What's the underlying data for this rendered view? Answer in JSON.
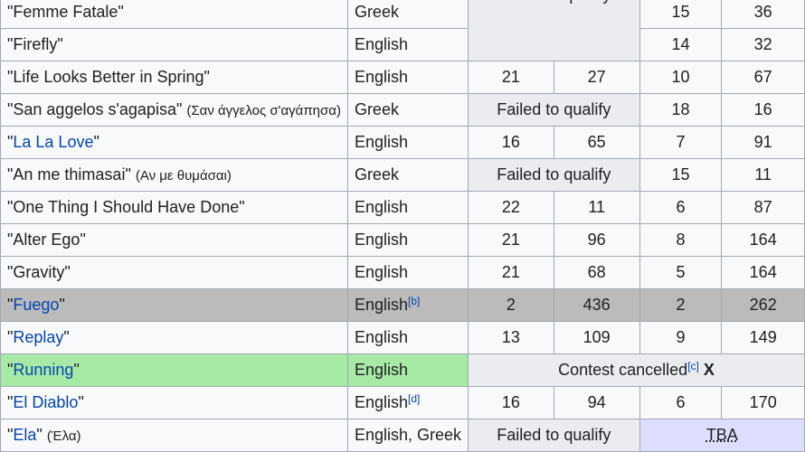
{
  "failed_label": "Failed to qualify",
  "rows": [
    {
      "title": "Femme Fatale",
      "alt": "",
      "linked": false,
      "language": "Greek",
      "sup": "",
      "pos1": "",
      "pts1": "",
      "pos2": "15",
      "pts2": "36"
    },
    {
      "title": "Firefly",
      "alt": "",
      "linked": false,
      "language": "English",
      "sup": "",
      "pos1": "",
      "pts1": "",
      "pos2": "14",
      "pts2": "32"
    },
    {
      "title": "Life Looks Better in Spring",
      "alt": "",
      "linked": false,
      "language": "English",
      "sup": "",
      "pos1": "21",
      "pts1": "27",
      "pos2": "10",
      "pts2": "67"
    },
    {
      "title": "San aggelos s'agapisa",
      "alt": "(Σαν άγγελος σ'αγάπησα)",
      "linked": false,
      "language": "Greek",
      "sup": "",
      "pos1": "",
      "pts1": "",
      "pos2": "18",
      "pts2": "16"
    },
    {
      "title": "La La Love",
      "alt": "",
      "linked": true,
      "language": "English",
      "sup": "",
      "pos1": "16",
      "pts1": "65",
      "pos2": "7",
      "pts2": "91"
    },
    {
      "title": "An me thimasai",
      "alt": "(Αν με θυμάσαι)",
      "linked": false,
      "language": "Greek",
      "sup": "",
      "pos1": "",
      "pts1": "",
      "pos2": "15",
      "pts2": "11"
    },
    {
      "title": "One Thing I Should Have Done",
      "alt": "",
      "linked": false,
      "language": "English",
      "sup": "",
      "pos1": "22",
      "pts1": "11",
      "pos2": "6",
      "pts2": "87"
    },
    {
      "title": "Alter Ego",
      "alt": "",
      "linked": false,
      "language": "English",
      "sup": "",
      "pos1": "21",
      "pts1": "96",
      "pos2": "8",
      "pts2": "164"
    },
    {
      "title": "Gravity",
      "alt": "",
      "linked": false,
      "language": "English",
      "sup": "",
      "pos1": "21",
      "pts1": "68",
      "pos2": "5",
      "pts2": "164"
    },
    {
      "title": "Fuego",
      "alt": "",
      "linked": true,
      "language": "English",
      "sup": "[b]",
      "pos1": "2",
      "pts1": "436",
      "pos2": "2",
      "pts2": "262"
    },
    {
      "title": "Replay",
      "alt": "",
      "linked": true,
      "language": "English",
      "sup": "",
      "pos1": "13",
      "pts1": "109",
      "pos2": "9",
      "pts2": "149"
    },
    {
      "title": "Running",
      "alt": "",
      "linked": true,
      "language": "English",
      "sup": "",
      "pos1": "",
      "pts1": "",
      "pos2": "",
      "pts2": ""
    },
    {
      "title": "El Diablo",
      "alt": "",
      "linked": true,
      "language": "English",
      "sup": "[d]",
      "pos1": "16",
      "pts1": "94",
      "pos2": "6",
      "pts2": "170"
    },
    {
      "title": "Ela",
      "alt": "(Έλα)",
      "linked": true,
      "language": "English, Greek",
      "sup": "",
      "pos1": "",
      "pts1": "",
      "pos2": "",
      "pts2": ""
    }
  ],
  "cancelled": {
    "label": "Contest cancelled",
    "sup": "[c]",
    "mark": "X"
  },
  "tba_label": "TBA",
  "colors": {
    "link": "#0645ad",
    "header_gray": "#eaecf0",
    "winner_gray": "#bbbbbb",
    "running_green": "#a6eaa6",
    "tba_purple": "#ddddff",
    "border": "#a2a9b1"
  }
}
